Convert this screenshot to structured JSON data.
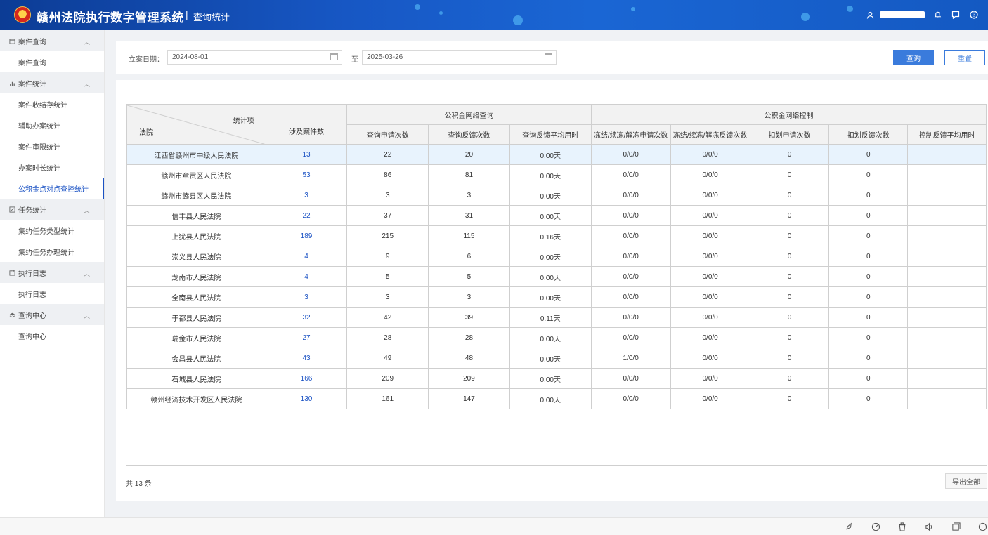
{
  "header": {
    "app_title": "赣州法院执行数字管理系统",
    "separator": "|",
    "page_title": "查询统计"
  },
  "sidebar": {
    "groups": [
      {
        "label": "案件查询",
        "items": [
          {
            "label": "案件查询"
          }
        ]
      },
      {
        "label": "案件统计",
        "items": [
          {
            "label": "案件收结存统计"
          },
          {
            "label": "辅助办案统计"
          },
          {
            "label": "案件审限统计"
          },
          {
            "label": "办案时长统计"
          },
          {
            "label": "公积金点对点查控统计",
            "active": true
          }
        ]
      },
      {
        "label": "任务统计",
        "items": [
          {
            "label": "集约任务类型统计"
          },
          {
            "label": "集约任务办理统计"
          }
        ]
      },
      {
        "label": "执行日志",
        "items": [
          {
            "label": "执行日志"
          }
        ]
      },
      {
        "label": "查询中心",
        "items": [
          {
            "label": "查询中心"
          }
        ]
      }
    ]
  },
  "filter": {
    "date_label": "立案日期：",
    "start_date": "2024-08-01",
    "to_label": "至",
    "end_date": "2025-03-26",
    "query_button": "查询",
    "reset_button": "重置"
  },
  "table": {
    "corner_top": "统计项",
    "corner_bottom": "法院",
    "col_cases": "涉及案件数",
    "group_query": "公积金网络查询",
    "group_control": "公积金网络控制",
    "sub_headers": [
      "查询申请次数",
      "查询反馈次数",
      "查询反馈平均用时",
      "冻结/续冻/解冻申请次数",
      "冻结/续冻/解冻反馈次数",
      "扣划申请次数",
      "扣划反馈次数",
      "控制反馈平均用时"
    ],
    "rows": [
      [
        "江西省赣州市中级人民法院",
        "13",
        "22",
        "20",
        "0.00天",
        "0/0/0",
        "0/0/0",
        "0",
        "0",
        ""
      ],
      [
        "赣州市章贡区人民法院",
        "53",
        "86",
        "81",
        "0.00天",
        "0/0/0",
        "0/0/0",
        "0",
        "0",
        ""
      ],
      [
        "赣州市赣县区人民法院",
        "3",
        "3",
        "3",
        "0.00天",
        "0/0/0",
        "0/0/0",
        "0",
        "0",
        ""
      ],
      [
        "信丰县人民法院",
        "22",
        "37",
        "31",
        "0.00天",
        "0/0/0",
        "0/0/0",
        "0",
        "0",
        ""
      ],
      [
        "上犹县人民法院",
        "189",
        "215",
        "115",
        "0.16天",
        "0/0/0",
        "0/0/0",
        "0",
        "0",
        ""
      ],
      [
        "崇义县人民法院",
        "4",
        "9",
        "6",
        "0.00天",
        "0/0/0",
        "0/0/0",
        "0",
        "0",
        ""
      ],
      [
        "龙南市人民法院",
        "4",
        "5",
        "5",
        "0.00天",
        "0/0/0",
        "0/0/0",
        "0",
        "0",
        ""
      ],
      [
        "全南县人民法院",
        "3",
        "3",
        "3",
        "0.00天",
        "0/0/0",
        "0/0/0",
        "0",
        "0",
        ""
      ],
      [
        "于都县人民法院",
        "32",
        "42",
        "39",
        "0.11天",
        "0/0/0",
        "0/0/0",
        "0",
        "0",
        ""
      ],
      [
        "瑞金市人民法院",
        "27",
        "28",
        "28",
        "0.00天",
        "0/0/0",
        "0/0/0",
        "0",
        "0",
        ""
      ],
      [
        "会昌县人民法院",
        "43",
        "49",
        "48",
        "0.00天",
        "1/0/0",
        "0/0/0",
        "0",
        "0",
        ""
      ],
      [
        "石城县人民法院",
        "166",
        "209",
        "209",
        "0.00天",
        "0/0/0",
        "0/0/0",
        "0",
        "0",
        ""
      ],
      [
        "赣州经济技术开发区人民法院",
        "130",
        "161",
        "147",
        "0.00天",
        "0/0/0",
        "0/0/0",
        "0",
        "0",
        ""
      ]
    ]
  },
  "footer": {
    "total": "共 13 条",
    "export_button": "导出全部"
  },
  "colors": {
    "header_bg": "#1757c4",
    "accent": "#1a52c4",
    "highlight_row": "#e8f3fd"
  }
}
